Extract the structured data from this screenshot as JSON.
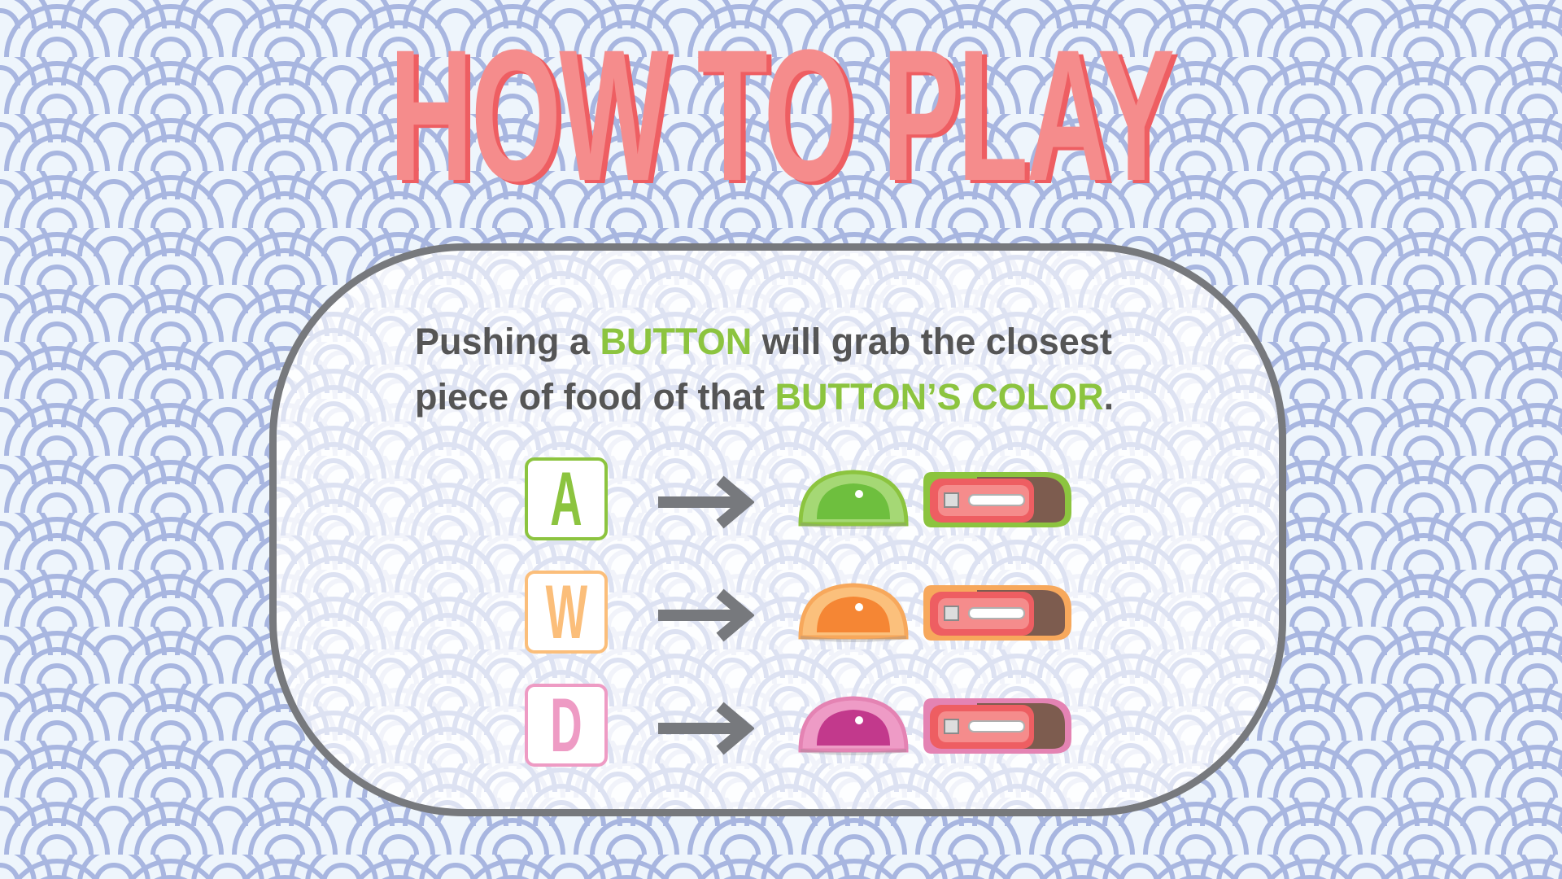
{
  "title": "HOW TO PLAY",
  "instructions": {
    "line1_pre": "Pushing a ",
    "line1_highlight": "BUTTON",
    "line1_post": " will grab the closest",
    "line2_pre": "piece of food of that ",
    "line2_highlight": "BUTTON’S COLOR",
    "line2_post": "."
  },
  "rows": [
    {
      "key": "A",
      "key_color": "#8cc43f",
      "food_fill": "#6ebf3e",
      "food_shell": "#a5d875",
      "food_outline": "#8cc43f"
    },
    {
      "key": "W",
      "key_color": "#fbbe7a",
      "food_fill": "#f58634",
      "food_shell": "#fbc07c",
      "food_outline": "#f7a85c"
    },
    {
      "key": "D",
      "key_color": "#ee9bc4",
      "food_fill": "#c2398c",
      "food_shell": "#ee9bc6",
      "food_outline": "#e483b3"
    }
  ],
  "colors": {
    "title": "#f58c8c",
    "title_shadow": "#ee5e62",
    "highlight": "#8cc43f",
    "text": "#555555",
    "panel_border": "#77797d",
    "arrow": "#77797d",
    "wave_pattern": "#a8b6e0"
  },
  "icons": {
    "arrow": "right-arrow-icon",
    "food_a": "mochi-icon",
    "food_b": "nigiri-sushi-icon"
  }
}
